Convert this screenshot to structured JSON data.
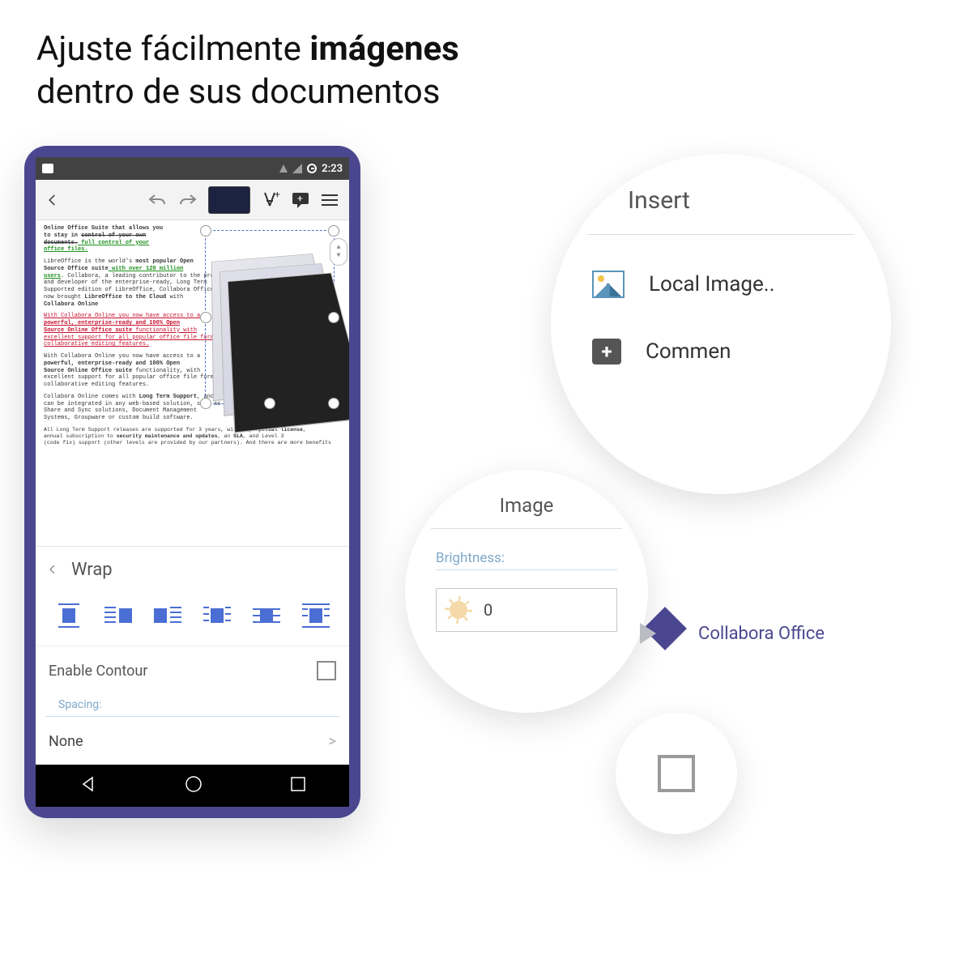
{
  "headline": {
    "part1": "Ajuste fácilmente ",
    "bold": "imágenes",
    "part2": "dentro de sus documentos"
  },
  "statusbar": {
    "time": "2:23"
  },
  "doc": {
    "p1a": "Online Office Suite that allows you",
    "p1b": "to stay in ",
    "p1c": "control of your own",
    "p1d": "documents.",
    "p1e": " full control of your",
    "p1f": "office files.",
    "p2a": "LibreOffice is the world's ",
    "p2b": "most popular Open",
    "p2c": "Source Office suite",
    "p2d": " with over 120 million",
    "p2e": "users",
    "p2f": ". Collabora, a leading contributor to the project,",
    "p2g": "and developer of the enterprise-ready, Long Term",
    "p2h": "Supported edition of LibreOffice, Collabora Office, has",
    "p2i": "now brought ",
    "p2j": "LibreOffice to the Cloud",
    "p2k": " with",
    "p2l": "Collabora Online",
    "p3a": "With Collabora Online you now have access to a",
    "p3b": "powerful, enterprise-ready and 100% Open",
    "p3c": "Source Online Office suite",
    "p3d": " functionality with",
    "p3e": "excellent support for all popular office file formats and",
    "p3f": "collaborative editing features.",
    "p4a": "With Collabora Online you now have access to a",
    "p4b": "powerful, enterprise-ready and 100% Open",
    "p4c": "Source Online Office suite",
    "p4d": " functionality, with",
    "p4e": "excellent support for all popular office file formats and",
    "p4f": "collaborative editing features.",
    "p5a": "Collabora Online comes with ",
    "p5b": "Long Term Support",
    "p5c": ", and",
    "p5d": "can be integrated in any web-based solution, such as File",
    "p5e": "Share and Sync solutions, Document Management",
    "p5f": "Systems, Groupware or custom build software.",
    "p6a": "All Long Term Support releases are supported for 3 years, with a ",
    "p6b": "perpetual license",
    "p6c": ",",
    "p6d": "annual subscription to ",
    "p6e": "security maintenance and updates",
    "p6f": ", an ",
    "p6g": "SLA",
    "p6h": ", and Level 3",
    "p6i": "(code fix) support (other levels are provided by our partners). And there are more benefits"
  },
  "wrap": {
    "title": "Wrap",
    "enable_contour": "Enable Contour",
    "spacing_label": "Spacing:",
    "none": "None"
  },
  "insert": {
    "title": "Insert",
    "local_image": "Local Image..",
    "comment": "Commen"
  },
  "bright": {
    "title": "Image",
    "label": "Brightness:",
    "value": "0"
  },
  "brand": {
    "name": "Collabora Office"
  }
}
